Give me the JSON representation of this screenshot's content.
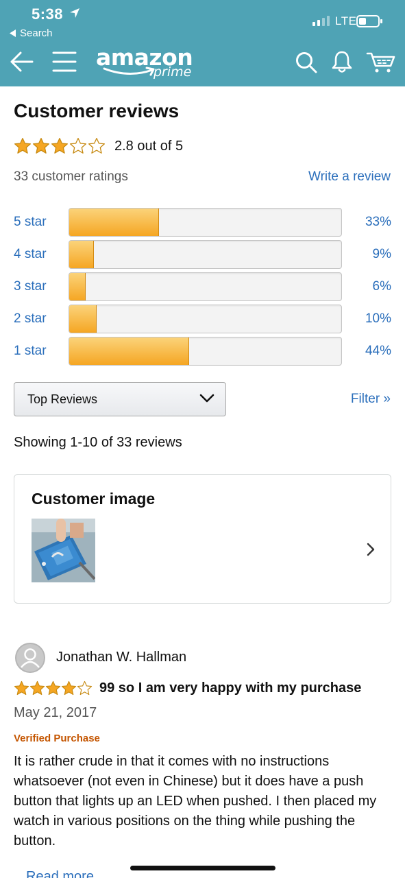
{
  "status_bar": {
    "time": "5:38",
    "back_app": "Search",
    "network": "LTE"
  },
  "header": {
    "logo_wordmark": "amazon",
    "logo_tier": "prime",
    "icons": [
      "back-arrow-icon",
      "menu-icon",
      "search-icon",
      "bell-icon",
      "cart-icon"
    ],
    "bar_color": "#4fa3b5"
  },
  "reviews": {
    "title": "Customer reviews",
    "rating": 2.8,
    "rating_text": "2.8 out of 5",
    "ratings_count": "33 customer ratings",
    "write_review": "Write a review",
    "histogram": [
      {
        "label": "5 star",
        "pct_text": "33%",
        "pct": 33
      },
      {
        "label": "4 star",
        "pct_text": "9%",
        "pct": 9
      },
      {
        "label": "3 star",
        "pct_text": "6%",
        "pct": 6
      },
      {
        "label": "2 star",
        "pct_text": "10%",
        "pct": 10
      },
      {
        "label": "1 star",
        "pct_text": "44%",
        "pct": 44
      }
    ],
    "sort_selected": "Top Reviews",
    "filter": "Filter »",
    "showing": "Showing 1-10 of 33 reviews",
    "customer_image_title": "Customer image"
  },
  "review": {
    "reviewer": "Jonathan W. Hallman",
    "stars": 4,
    "title": "99 so I am very happy with my purchase",
    "date": "May 21, 2017",
    "badge": "Verified Purchase",
    "body": "It is rather crude in that it comes with no instructions whatsoever (not even in Chinese) but it does have a push button that lights up an LED when pushed. I then placed my watch in various positions on the thing while pushing the button.",
    "read_more": "Read more"
  },
  "colors": {
    "link": "#2a6ebb",
    "star": "#f5a623",
    "verified": "#c45500"
  }
}
